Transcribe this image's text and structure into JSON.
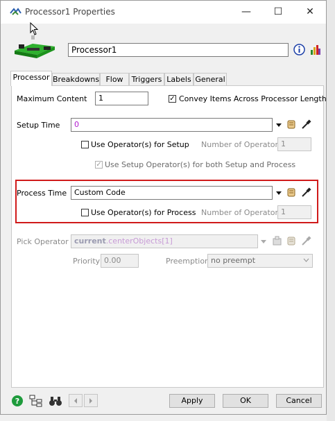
{
  "window": {
    "title": "Processor1  Properties",
    "minimize_glyph": "—",
    "maximize_glyph": "☐",
    "close_glyph": "✕"
  },
  "object": {
    "name": "Processor1",
    "info_icon": "info-icon",
    "graph_icon": "stats-chart-icon"
  },
  "tabs": [
    "Processor",
    "Breakdowns",
    "Flow",
    "Triggers",
    "Labels",
    "General"
  ],
  "processor": {
    "max_content_label": "Maximum Content",
    "max_content_value": "1",
    "convey_label": "Convey Items Across Processor Length",
    "convey_checked": true,
    "setup_time_label": "Setup Time",
    "setup_time_value": "0",
    "setup_use_operators_label": "Use Operator(s) for Setup",
    "setup_num_operators_label": "Number of Operators",
    "setup_num_operators_value": "1",
    "setup_both_label": "Use Setup Operator(s) for both Setup and Process",
    "setup_both_checked": true,
    "process_time_label": "Process Time",
    "process_time_value": "Custom Code",
    "process_use_operators_label": "Use Operator(s) for Process",
    "process_num_operators_label": "Number of Operators",
    "process_num_operators_value": "1",
    "pick_operator_label": "Pick Operator",
    "pick_operator_keyword": "current",
    "pick_operator_rest": ".centerObjects[1]",
    "priority_label": "Priority",
    "priority_value": "0.00",
    "preemption_label": "Preemption",
    "preemption_value": "no preempt"
  },
  "footer": {
    "apply": "Apply",
    "ok": "OK",
    "cancel": "Cancel"
  },
  "colors": {
    "highlight": "#d01a1a",
    "value_purple": "#b11ccf",
    "help_green": "#1e9b3c"
  }
}
